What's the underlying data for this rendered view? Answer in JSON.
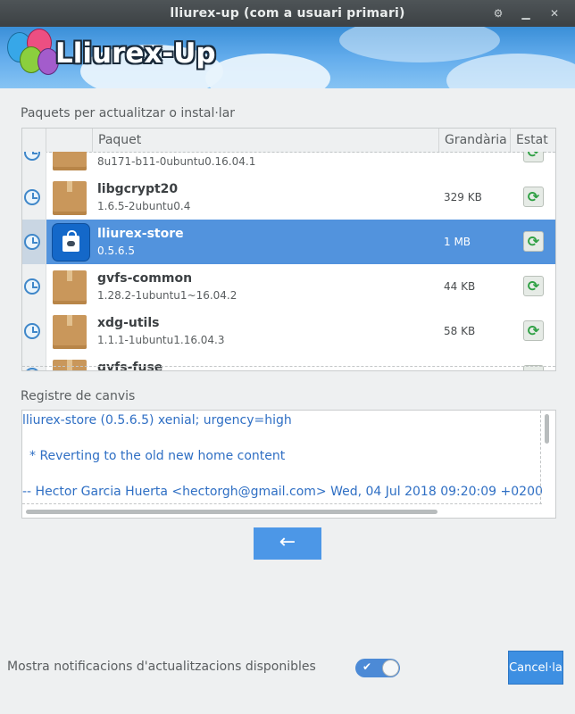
{
  "window": {
    "title": "lliurex-up (com a usuari primari)",
    "controls": [
      "settings-icon",
      "minimize-icon",
      "close-icon"
    ]
  },
  "banner": {
    "title": "Lliurex-Up"
  },
  "packages": {
    "section_label": "Paquets per actualitzar o instal·lar",
    "columns": [
      "Paquet",
      "Grandària",
      "Estat"
    ],
    "rows": [
      {
        "name": "",
        "version": "8u171-b11-0ubuntu0.16.04.1",
        "size": "",
        "icon": "package-icon",
        "selected": false
      },
      {
        "name": "libgcrypt20",
        "version": "1.6.5-2ubuntu0.4",
        "size": "329 KB",
        "icon": "package-icon",
        "selected": false
      },
      {
        "name": "lliurex-store",
        "version": "0.5.6.5",
        "size": "1 MB",
        "icon": "lliurex-store-icon",
        "selected": true
      },
      {
        "name": "gvfs-common",
        "version": "1.28.2-1ubuntu1~16.04.2",
        "size": "44 KB",
        "icon": "package-icon",
        "selected": false
      },
      {
        "name": "xdg-utils",
        "version": "1.1.1-1ubuntu1.16.04.3",
        "size": "58 KB",
        "icon": "package-icon",
        "selected": false
      },
      {
        "name": "gvfs-fuse",
        "version": "",
        "size": "",
        "icon": "package-icon",
        "selected": false
      }
    ]
  },
  "changelog": {
    "section_label": "Registre de canvis",
    "lines": [
      "lliurex-store (0.5.6.5) xenial; urgency=high",
      " * Reverting to the old new home content",
      "-- Hector Garcia Huerta <hectorgh@gmail.com>  Wed, 04 Jul 2018 09:20:09 +0200"
    ]
  },
  "actions": {
    "back_label": "←",
    "notifications_label": "Mostra notificacions d'actualitzacions disponibles",
    "notifications_enabled": true,
    "toggle_check": "✔",
    "cancel_label": "Cancel·la"
  },
  "colors": {
    "accent": "#4c97e7",
    "selected_row": "#5293dd",
    "log_text": "#2f6fc4"
  }
}
